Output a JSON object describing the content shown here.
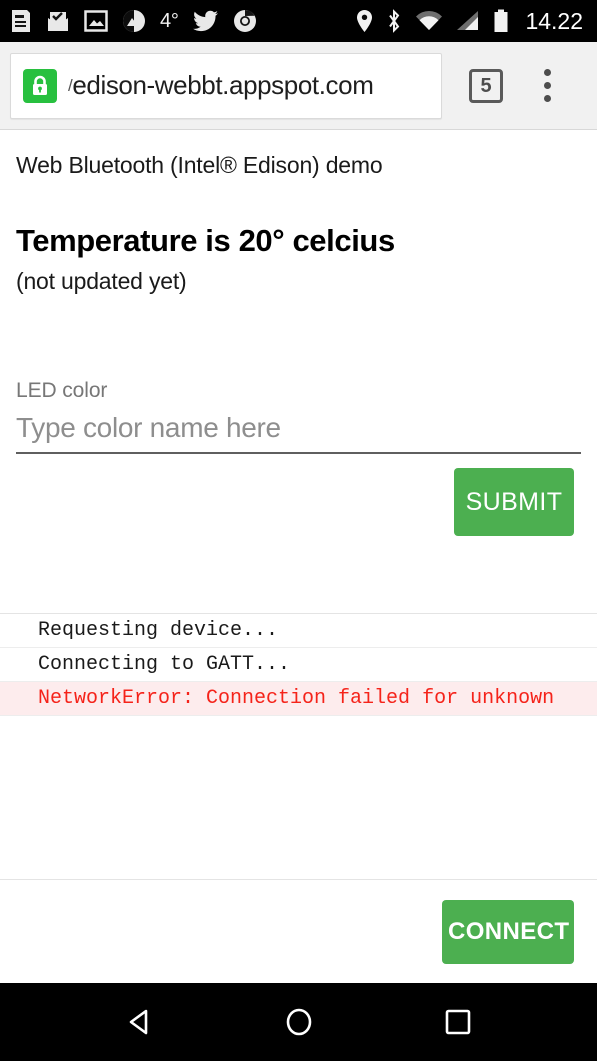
{
  "status_bar": {
    "time": "14.22",
    "temperature": "4°",
    "left_icons": [
      {
        "name": "news-feed-icon"
      },
      {
        "name": "mail-checked-icon"
      },
      {
        "name": "photo-icon"
      },
      {
        "name": "weather-circle-icon"
      },
      {
        "name": "twitter-bird-icon"
      },
      {
        "name": "chrome-icon"
      }
    ],
    "right_icons": [
      {
        "name": "location-pin-icon"
      },
      {
        "name": "bluetooth-icon"
      },
      {
        "name": "wifi-icon"
      },
      {
        "name": "cellular-signal-icon"
      },
      {
        "name": "battery-icon"
      }
    ]
  },
  "browser": {
    "url_scheme_fragment": "/",
    "url": "edison-webbt.appspot.com",
    "security_icon": "lock-icon",
    "security_color": "#28c03f",
    "tab_count": "5",
    "menu_icon": "overflow-menu-icon"
  },
  "page": {
    "subtitle": "Web Bluetooth (Intel® Edison) demo",
    "temperature_heading": "Temperature is 20° celcius",
    "temperature_note": "(not updated yet)",
    "form": {
      "led_color_label": "LED color",
      "led_color_value": "",
      "led_color_placeholder": "Type color name here",
      "submit_label": "SUBMIT"
    },
    "log": [
      {
        "text": "Requesting device...",
        "level": "info"
      },
      {
        "text": "Connecting to GATT...",
        "level": "info"
      },
      {
        "text": "NetworkError: Connection failed for unknown",
        "level": "error"
      }
    ],
    "connect_label": "CONNECT",
    "accent_color": "#4caf50",
    "error_color": "#f5231a",
    "error_background": "#fdeced"
  },
  "nav_bar": {
    "back_label": "back-icon",
    "home_label": "home-icon",
    "recents_label": "recents-icon"
  }
}
